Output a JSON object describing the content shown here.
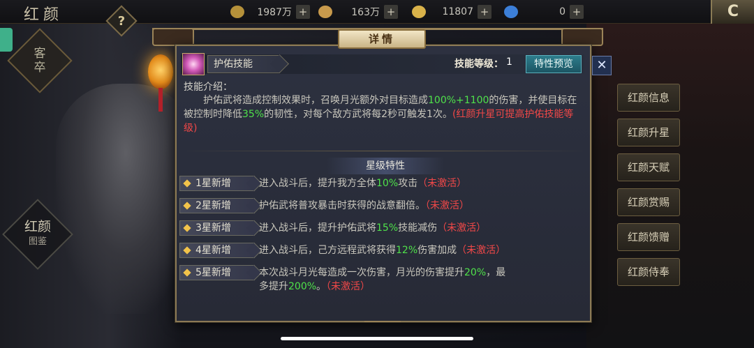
{
  "game_title": "红颜",
  "help_icon_glyph": "?",
  "resources": [
    {
      "icon": "wheat-icon",
      "color": "#b5913a",
      "value": "1987万",
      "plus": "+"
    },
    {
      "icon": "ingot-icon",
      "color": "#c89a4c",
      "value": "163万",
      "plus": "+"
    },
    {
      "icon": "gold-ingot-icon",
      "color": "#d9b24a",
      "value": "11807",
      "plus": "+"
    },
    {
      "icon": "water-drop-icon",
      "color": "#3c7fd8",
      "value": "0",
      "plus": "+"
    }
  ],
  "left_labels": {
    "keju_line1": "客",
    "keju_line2": "卒",
    "tujian_line1": "红颜",
    "tujian_line2": "图鉴"
  },
  "side_menu": [
    "红颜信息",
    "红颜升星",
    "红颜天赋",
    "红颜赏赐",
    "红颜馈赠",
    "红颜侍奉"
  ],
  "panel": {
    "header": "详情",
    "close_glyph": "✕",
    "skill_name": "护佑技能",
    "level_label": "技能等级：",
    "level_value": "1",
    "preview_button": "特性预览",
    "intro_title": "技能介绍：",
    "intro": {
      "p1": "护佑武将造成控制效果时，召唤月光额外对目标造成",
      "hl1": "100%+1100",
      "p2": "的伤害，并使目标在被控制时降低",
      "hl2": "35%",
      "p3": "的韧性，对每个敌方武将每2秒可触发1次。",
      "red": "(红颜升星可提高护佑技能等级)"
    },
    "star_title": "星级特性",
    "stars": [
      {
        "tag": "1星新增",
        "pre": "进入战斗后，提升我方全体",
        "hl": "10%",
        "post": "攻击",
        "status": "（未激活）"
      },
      {
        "tag": "2星新增",
        "pre": "护佑武将普攻暴击时获得的战意翻倍。",
        "hl": "",
        "post": "",
        "status": "（未激活）"
      },
      {
        "tag": "3星新增",
        "pre": "进入战斗后，提升护佑武将",
        "hl": "15%",
        "post": "技能减伤",
        "status": "（未激活）"
      },
      {
        "tag": "4星新增",
        "pre": "进入战斗后，己方远程武将获得",
        "hl": "12%",
        "post": "伤害加成",
        "status": "（未激活）"
      },
      {
        "tag": "5星新增",
        "pre": "本次战斗月光每造成一次伤害，月光的伤害提升",
        "hl": "20%",
        "post": "，最多提升",
        "hl2": "200%",
        "post2": "。",
        "status": "（未激活）"
      }
    ]
  },
  "colors": {
    "highlight_green": "#4fe24a",
    "inactive_red": "#f24848",
    "panel_border": "#8c7a55"
  }
}
